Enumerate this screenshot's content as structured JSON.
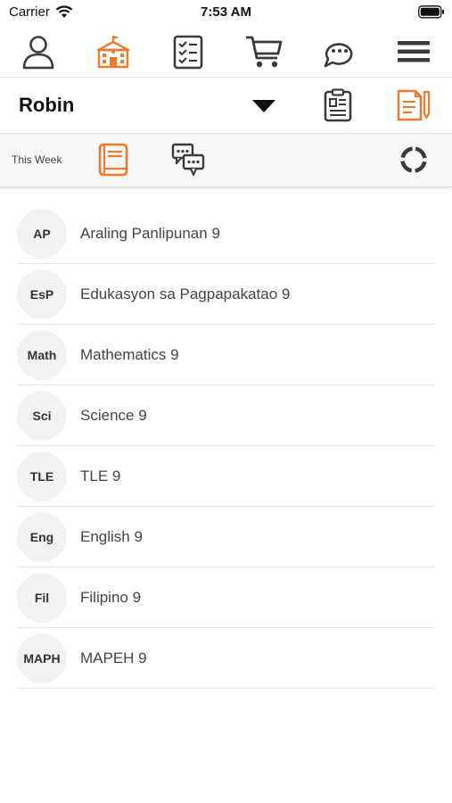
{
  "status_bar": {
    "carrier": "Carrier",
    "time": "7:53 AM"
  },
  "colors": {
    "accent": "#f07a2c",
    "icon_dark": "#3a3a3a",
    "divider": "#e3e3e3"
  },
  "top_nav": {
    "items": [
      {
        "icon": "person-icon",
        "active": false
      },
      {
        "icon": "school-icon",
        "active": true
      },
      {
        "icon": "checklist-icon",
        "active": false
      },
      {
        "icon": "cart-icon",
        "active": false
      },
      {
        "icon": "chat-icon",
        "active": false
      },
      {
        "icon": "menu-icon",
        "active": false
      }
    ]
  },
  "user": {
    "name": "Robin",
    "icons": [
      "report-card-icon",
      "notes-icon"
    ]
  },
  "filter": {
    "label": "This Week",
    "icons": [
      "book-icon",
      "discussion-icon",
      "progress-ring-icon"
    ]
  },
  "subjects": [
    {
      "abbr": "AP",
      "name": "Araling Panlipunan 9"
    },
    {
      "abbr": "EsP",
      "name": "Edukasyon sa Pagpapakatao 9"
    },
    {
      "abbr": "Math",
      "name": "Mathematics 9"
    },
    {
      "abbr": "Sci",
      "name": "Science 9"
    },
    {
      "abbr": "TLE",
      "name": "TLE 9"
    },
    {
      "abbr": "Eng",
      "name": "English 9"
    },
    {
      "abbr": "Fil",
      "name": "Filipino 9"
    },
    {
      "abbr": "MAPH",
      "name": "MAPEH 9"
    }
  ]
}
